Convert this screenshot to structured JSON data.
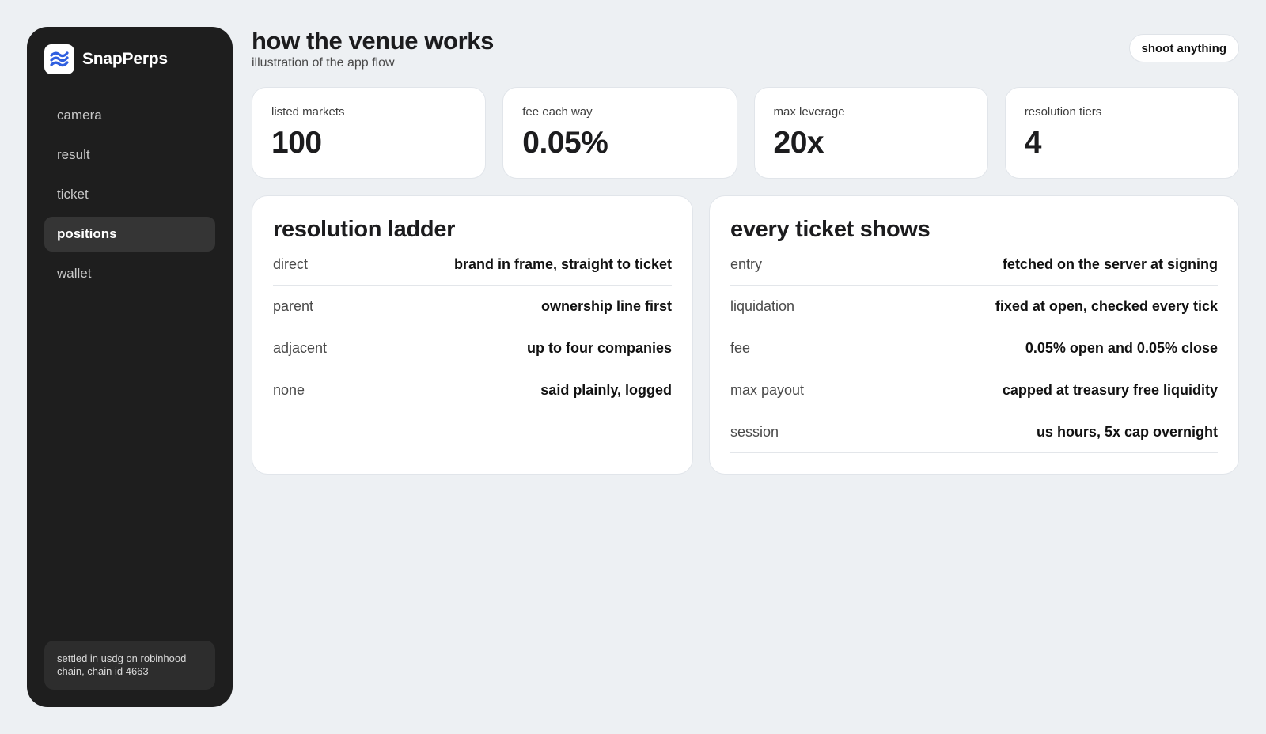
{
  "app": {
    "name": "SnapPerps"
  },
  "sidebar": {
    "items": [
      {
        "label": "camera",
        "active": false
      },
      {
        "label": "result",
        "active": false
      },
      {
        "label": "ticket",
        "active": false
      },
      {
        "label": "positions",
        "active": true
      },
      {
        "label": "wallet",
        "active": false
      }
    ],
    "footer": "settled in usdg on robinhood chain, chain id 4663"
  },
  "header": {
    "title": "how the venue works",
    "subtitle": "illustration of the app flow",
    "cta_label": "shoot anything"
  },
  "stats": [
    {
      "label": "listed markets",
      "value": "100"
    },
    {
      "label": "fee each way",
      "value": "0.05%"
    },
    {
      "label": "max leverage",
      "value": "20x"
    },
    {
      "label": "resolution tiers",
      "value": "4"
    }
  ],
  "ladder": {
    "title": "resolution ladder",
    "rows": [
      {
        "key": "direct",
        "value": "brand in frame, straight to ticket"
      },
      {
        "key": "parent",
        "value": "ownership line first"
      },
      {
        "key": "adjacent",
        "value": "up to four companies"
      },
      {
        "key": "none",
        "value": "said plainly, logged"
      }
    ]
  },
  "ticket": {
    "title": "every ticket shows",
    "rows": [
      {
        "key": "entry",
        "value": "fetched on the server at signing"
      },
      {
        "key": "liquidation",
        "value": "fixed at open, checked every tick"
      },
      {
        "key": "fee",
        "value": "0.05% open and 0.05% close"
      },
      {
        "key": "max payout",
        "value": "capped at treasury free liquidity"
      },
      {
        "key": "session",
        "value": "us hours, 5x cap overnight"
      }
    ]
  },
  "colors": {
    "background": "#edf0f3",
    "sidebar": "#1e1e1e",
    "sidebar_active": "#353535",
    "logo_accent": "#2f5fe0"
  }
}
